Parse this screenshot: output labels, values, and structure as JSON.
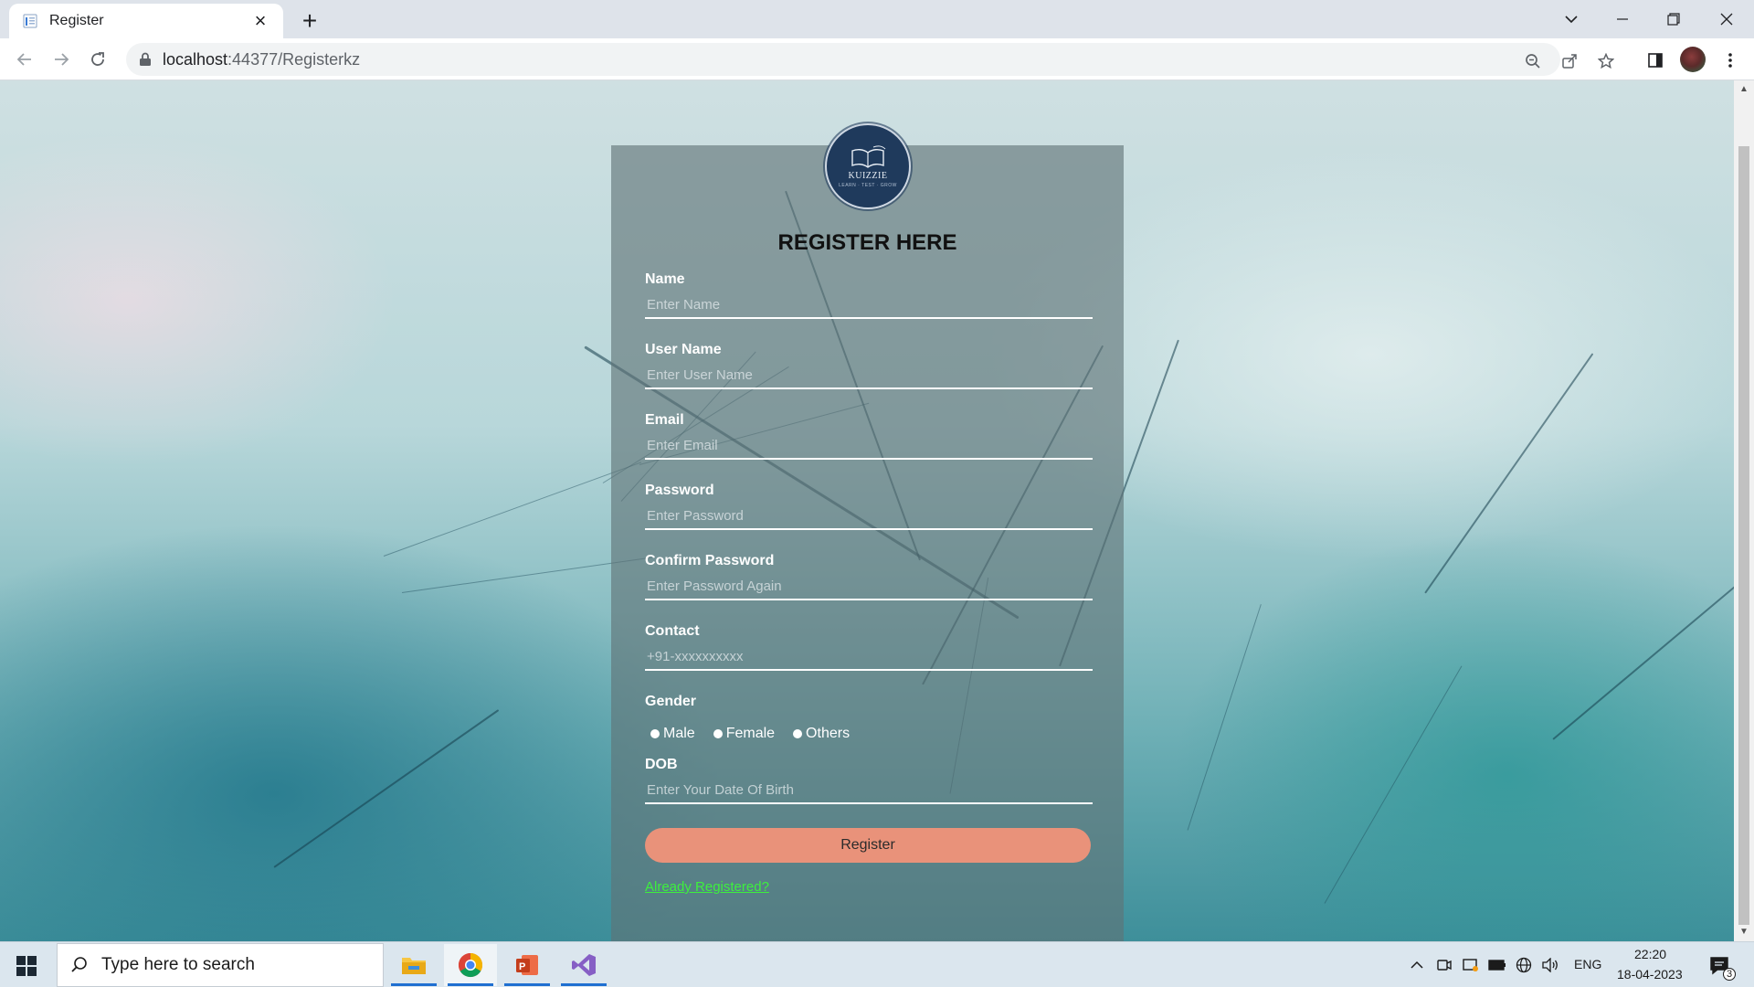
{
  "browser": {
    "tab_title": "Register",
    "new_tab_symbol": "+",
    "url_host": "localhost",
    "url_path": ":44377/Registerkz"
  },
  "logo": {
    "name": "KUIZZIE",
    "tagline": "LEARN · TEST · GROW"
  },
  "form": {
    "title": "REGISTER HERE",
    "fields": [
      {
        "label": "Name",
        "placeholder": "Enter Name"
      },
      {
        "label": "User Name",
        "placeholder": "Enter User Name"
      },
      {
        "label": "Email",
        "placeholder": "Enter Email"
      },
      {
        "label": "Password",
        "placeholder": "Enter Password"
      },
      {
        "label": "Confirm Password",
        "placeholder": "Enter Password Again"
      },
      {
        "label": "Contact",
        "placeholder": "+91-xxxxxxxxxx"
      }
    ],
    "gender_label": "Gender",
    "gender_options": [
      "Male",
      "Female",
      "Others"
    ],
    "dob_label": "DOB",
    "dob_placeholder": "Enter Your Date Of Birth",
    "register_button": "Register",
    "login_link": "Already Registered?"
  },
  "taskbar": {
    "search_placeholder": "Type here to search",
    "language": "ENG",
    "time": "22:20",
    "date": "18-04-2023",
    "notification_count": "3"
  },
  "colors": {
    "register_button": "#e9927a",
    "login_link": "#3df03d",
    "card_overlay": "#5f7376"
  }
}
